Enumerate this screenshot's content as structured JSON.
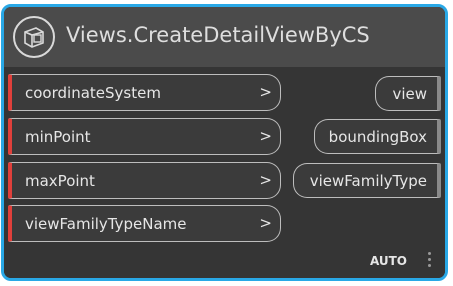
{
  "node": {
    "title": "Views.CreateDetailViewByCS",
    "icon": "detail-view-cube-icon",
    "accent_color": "#29a8e6",
    "input_marker_color": "#e0403b",
    "inputs": [
      {
        "label": "coordinateSystem",
        "chevron": ">"
      },
      {
        "label": "minPoint",
        "chevron": ">"
      },
      {
        "label": "maxPoint",
        "chevron": ">"
      },
      {
        "label": "viewFamilyTypeName",
        "chevron": ">"
      }
    ],
    "outputs": [
      {
        "label": "view"
      },
      {
        "label": "boundingBox"
      },
      {
        "label": "viewFamilyType"
      }
    ],
    "lacing": "AUTO"
  }
}
